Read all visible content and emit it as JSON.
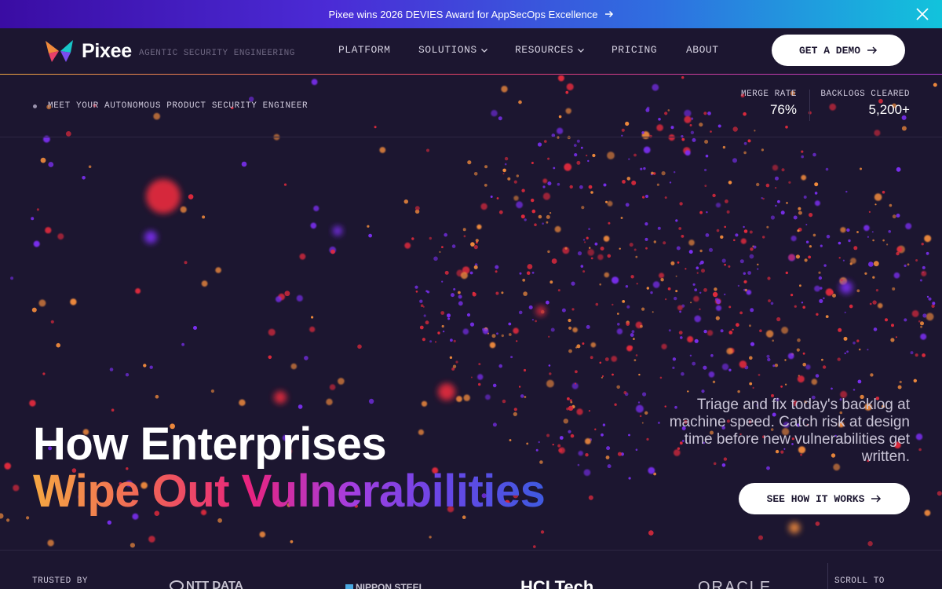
{
  "banner": {
    "text": "Pixee wins 2026 DEVIES Award for AppSecOps Excellence",
    "close_icon": "close-icon",
    "arrow_icon": "arrow-right-icon"
  },
  "nav": {
    "brand": "Pixee",
    "tagline": "AGENTIC SECURITY ENGINEERING",
    "items": [
      {
        "label": "PLATFORM",
        "dropdown": false
      },
      {
        "label": "SOLUTIONS",
        "dropdown": true
      },
      {
        "label": "RESOURCES",
        "dropdown": true
      },
      {
        "label": "PRICING",
        "dropdown": false
      },
      {
        "label": "ABOUT",
        "dropdown": false
      }
    ],
    "cta": "GET A DEMO"
  },
  "status": {
    "meet": "MEET YOUR AUTONOMOUS PRODUCT SECURITY ENGINEER",
    "stats": [
      {
        "label": "MERGE RATE",
        "value": "76%"
      },
      {
        "label": "BACKLOGS CLEARED",
        "value": "5,200+"
      }
    ]
  },
  "hero": {
    "line1": "How Enterprises",
    "line2": "Wipe Out Vulnerabilities",
    "subtext": "Triage and fix today's backlog at machine speed. Catch risk at design time before new vulnerabilities get written.",
    "cta": "SEE HOW IT WORKS"
  },
  "trusted": {
    "label": "TRUSTED BY",
    "logos": [
      "NTT DATA",
      "NIPPON STEEL",
      "HCLTech",
      "ORACLE"
    ],
    "scroll_label": "SCROLL TO"
  },
  "colors": {
    "bg": "#1c1630",
    "red": "#e02a3c",
    "purple": "#7a2ff0",
    "orange": "#f08a3c"
  }
}
